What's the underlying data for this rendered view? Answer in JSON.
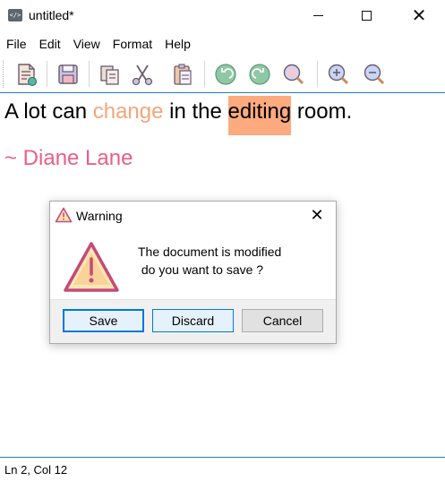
{
  "window": {
    "title": "untitled*",
    "app_icon_glyph": "</>"
  },
  "menu": [
    "File",
    "Edit",
    "Format",
    "Help"
  ],
  "menu_full": {
    "file": "File",
    "edit": "Edit",
    "view": "View",
    "format": "Format",
    "help": "Help"
  },
  "toolbar": {
    "buttons": [
      "new-document-icon",
      "save-icon",
      "copy-icon",
      "cut-icon",
      "paste-icon",
      "undo-icon",
      "redo-icon",
      "zoom-reset-icon",
      "zoom-in-icon",
      "zoom-out-icon"
    ]
  },
  "editor": {
    "line1": {
      "part1": "A lot can ",
      "part2": "change",
      "part3": " in the ",
      "part4": "editing",
      "part5": " room."
    },
    "line2": "~ Diane Lane",
    "colors": {
      "orange_text": "#f5a679",
      "highlight_bg": "#fcaa7e",
      "pink_text": "#eb5f86"
    }
  },
  "status": {
    "text": "Ln 2, Col 12"
  },
  "dialog": {
    "title": "Warning",
    "message": "The document is modified\n do you want to save ?",
    "buttons": {
      "save": "Save",
      "discard": "Discard",
      "cancel": "Cancel"
    },
    "accent": "#0078d7"
  }
}
